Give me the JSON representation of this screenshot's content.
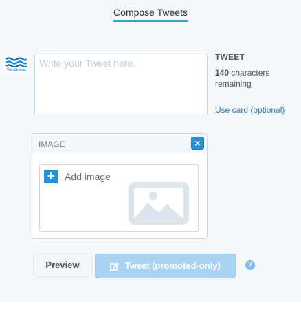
{
  "header": {
    "title": "Compose Tweets"
  },
  "account": {
    "brand": "WordStream",
    "logo_icon": "wordstream-waves-icon"
  },
  "composer": {
    "placeholder": "Write your Tweet here.",
    "side_heading": "TWEET",
    "char_count": "140",
    "char_suffix": "characters remaining",
    "card_link": "Use card (optional)"
  },
  "image_panel": {
    "label": "IMAGE",
    "close_icon": "close-icon",
    "add_label": "Add image",
    "add_icon": "plus-icon",
    "placeholder_icon": "image-placeholder-icon"
  },
  "actions": {
    "preview_label": "Preview",
    "tweet_label": "Tweet (promoted-only)",
    "tweet_icon": "compose-pen-icon",
    "help_icon": "question-icon",
    "help_symbol": "?"
  },
  "colors": {
    "accent": "#2a90d6",
    "tweet_disabled": "#a9d3f3",
    "panel_bg": "#f5f8fa"
  }
}
